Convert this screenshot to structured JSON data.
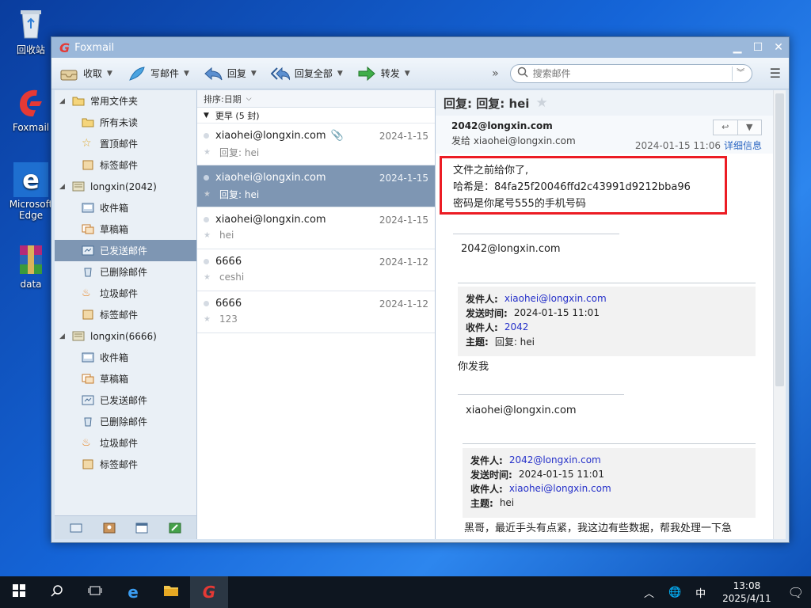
{
  "desktop": {
    "icons": [
      {
        "label": "回收站"
      },
      {
        "label": "Foxmail"
      },
      {
        "label": "Microsoft Edge"
      },
      {
        "label": "data"
      }
    ]
  },
  "window": {
    "title": "Foxmail"
  },
  "toolbar": {
    "receive": "收取",
    "compose": "写邮件",
    "reply": "回复",
    "reply_all": "回复全部",
    "forward": "转发",
    "more": "»",
    "search_placeholder": "搜索邮件"
  },
  "sidebar": {
    "common": "常用文件夹",
    "all_unread": "所有未读",
    "pinned": "置顶邮件",
    "tagged": "标签邮件",
    "account1": "longxin(2042)",
    "a1_inbox": "收件箱",
    "a1_drafts": "草稿箱",
    "a1_sent": "已发送邮件",
    "a1_deleted": "已删除邮件",
    "a1_junk": "垃圾邮件",
    "a1_tagged": "标签邮件",
    "account2": "longxin(6666)",
    "a2_inbox": "收件箱",
    "a2_drafts": "草稿箱",
    "a2_sent": "已发送邮件",
    "a2_deleted": "已删除邮件",
    "a2_junk": "垃圾邮件",
    "a2_tagged": "标签邮件"
  },
  "list": {
    "sort": "排序:日期",
    "group": "更早 (5 封)",
    "messages": [
      {
        "from": "xiaohei@longxin.com",
        "date": "2024-1-15",
        "subject": "回复: hei"
      },
      {
        "from": "xiaohei@longxin.com",
        "date": "2024-1-15",
        "subject": "回复: hei"
      },
      {
        "from": "xiaohei@longxin.com",
        "date": "2024-1-15",
        "subject": "hei"
      },
      {
        "from": "6666",
        "date": "2024-1-12",
        "subject": "ceshi"
      },
      {
        "from": "6666",
        "date": "2024-1-12",
        "subject": "123"
      }
    ]
  },
  "reader": {
    "title": "回复: 回复: hei",
    "from": "2042@longxin.com",
    "to": "发给 xiaohei@longxin.com",
    "datetime": "2024-01-15 11:06",
    "details": "详细信息",
    "line1": "文件之前给你了,",
    "line2": "哈希是：84fa25f20046ffd2c43991d9212bba96",
    "line3": "密码是你尾号555的手机号码",
    "sig1": "2042@longxin.com",
    "q1": {
      "from_label": "发件人:",
      "from": "xiaohei@longxin.com",
      "time_label": "发送时间:",
      "time": "2024-01-15 11:01",
      "to_label": "收件人:",
      "to": "2042",
      "subj_label": "主题:",
      "subj": "回复: hei"
    },
    "body2": "你发我",
    "sig2": "xiaohei@longxin.com",
    "q2": {
      "from_label": "发件人:",
      "from": "2042@longxin.com",
      "time_label": "发送时间:",
      "time": "2024-01-15 11:01",
      "to_label": "收件人:",
      "to": "xiaohei@longxin.com",
      "subj_label": "主题:",
      "subj": "hei"
    },
    "body3": "黑哥，最近手头有点紧，我这边有些数据，帮我处理一下急"
  },
  "taskbar": {
    "ime": "中",
    "time": "13:08",
    "date": "2025/4/11"
  }
}
